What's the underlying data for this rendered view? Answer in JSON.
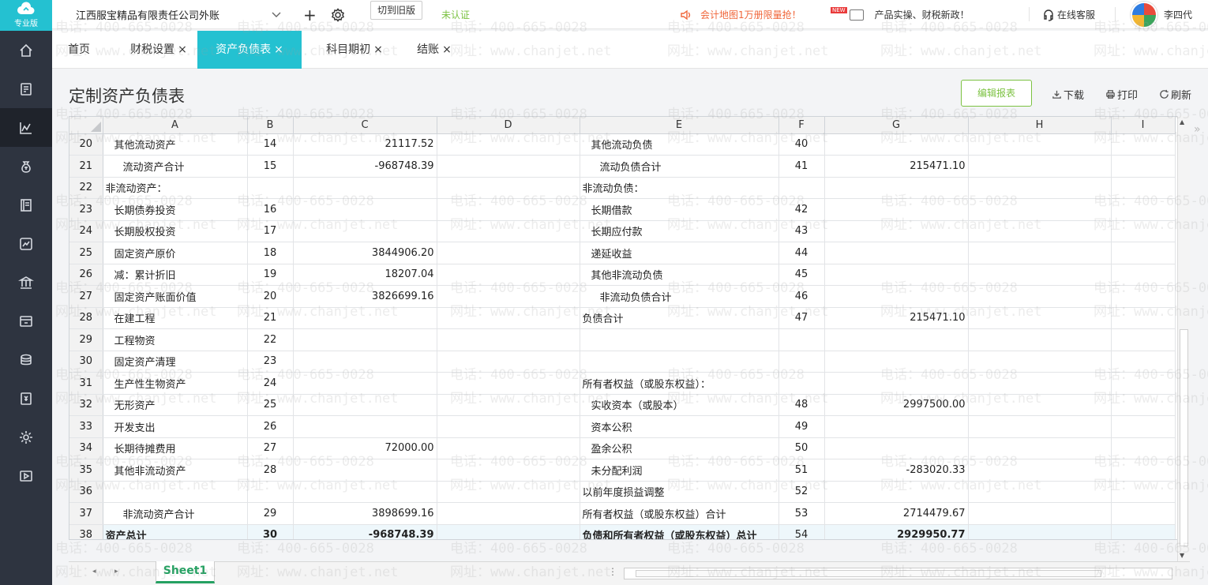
{
  "app": {
    "logo_label": "专业版",
    "company": "江西服宝精品有限责任公司外账",
    "switch_label": "切到旧版",
    "uncertified": "未认证",
    "promo": "会计地图1万册限量抢！",
    "news_badge": "NEW",
    "news": "产品实操、财税新政！",
    "service": "在线客服",
    "user": "李四代"
  },
  "tabs": [
    {
      "label": "首页"
    },
    {
      "label": "财税设置"
    },
    {
      "label": "资产负债表"
    },
    {
      "label": "科目期初"
    },
    {
      "label": "结账"
    }
  ],
  "tab_close": "×",
  "page": {
    "title": "定制资产负债表",
    "edit_label": "编辑报表",
    "download": "下载",
    "print": "打印",
    "refresh": "刷新"
  },
  "columns": [
    "A",
    "B",
    "C",
    "D",
    "E",
    "F",
    "G",
    "H",
    "I"
  ],
  "rows": [
    {
      "n": "20",
      "a": "其他流动资产",
      "ai": 1,
      "b": "14",
      "c": "21117.52",
      "e": "其他流动负债",
      "ei": 1,
      "f": "40",
      "g": ""
    },
    {
      "n": "21",
      "a": "流动资产合计",
      "ai": 2,
      "b": "15",
      "c": "-968748.39",
      "e": "流动负债合计",
      "ei": 2,
      "f": "41",
      "g": "215471.10"
    },
    {
      "n": "22",
      "a": "非流动资产：",
      "ai": 0,
      "b": "",
      "c": "",
      "e": "非流动负债：",
      "ei": 0,
      "f": "",
      "g": ""
    },
    {
      "n": "23",
      "a": "长期债券投资",
      "ai": 1,
      "b": "16",
      "c": "",
      "e": "长期借款",
      "ei": 1,
      "f": "42",
      "g": ""
    },
    {
      "n": "24",
      "a": "长期股权投资",
      "ai": 1,
      "b": "17",
      "c": "",
      "e": "长期应付款",
      "ei": 1,
      "f": "43",
      "g": ""
    },
    {
      "n": "25",
      "a": "固定资产原价",
      "ai": 1,
      "b": "18",
      "c": "3844906.20",
      "e": "递延收益",
      "ei": 1,
      "f": "44",
      "g": ""
    },
    {
      "n": "26",
      "a": "减：累计折旧",
      "ai": 1,
      "b": "19",
      "c": "18207.04",
      "e": "其他非流动负债",
      "ei": 1,
      "f": "45",
      "g": ""
    },
    {
      "n": "27",
      "a": "固定资产账面价值",
      "ai": 1,
      "b": "20",
      "c": "3826699.16",
      "e": "非流动负债合计",
      "ei": 2,
      "f": "46",
      "g": ""
    },
    {
      "n": "28",
      "a": "在建工程",
      "ai": 1,
      "b": "21",
      "c": "",
      "e": "负债合计",
      "ei": 0,
      "f": "47",
      "g": "215471.10"
    },
    {
      "n": "29",
      "a": "工程物资",
      "ai": 1,
      "b": "22",
      "c": "",
      "e": "",
      "ei": 0,
      "f": "",
      "g": ""
    },
    {
      "n": "30",
      "a": "固定资产清理",
      "ai": 1,
      "b": "23",
      "c": "",
      "e": "",
      "ei": 0,
      "f": "",
      "g": ""
    },
    {
      "n": "31",
      "a": "生产性生物资产",
      "ai": 1,
      "b": "24",
      "c": "",
      "e": "所有者权益（或股东权益）：",
      "ei": 0,
      "f": "",
      "g": ""
    },
    {
      "n": "32",
      "a": "无形资产",
      "ai": 1,
      "b": "25",
      "c": "",
      "e": "实收资本（或股本）",
      "ei": 1,
      "f": "48",
      "g": "2997500.00"
    },
    {
      "n": "33",
      "a": "开发支出",
      "ai": 1,
      "b": "26",
      "c": "",
      "e": "资本公积",
      "ei": 1,
      "f": "49",
      "g": ""
    },
    {
      "n": "34",
      "a": "长期待摊费用",
      "ai": 1,
      "b": "27",
      "c": "72000.00",
      "e": "盈余公积",
      "ei": 1,
      "f": "50",
      "g": ""
    },
    {
      "n": "35",
      "a": "其他非流动资产",
      "ai": 1,
      "b": "28",
      "c": "",
      "e": "未分配利润",
      "ei": 1,
      "f": "51",
      "g": "-283020.33"
    },
    {
      "n": "36",
      "a": "",
      "ai": 0,
      "b": "",
      "c": "",
      "e": "以前年度损益调整",
      "ei": 0,
      "f": "52",
      "g": ""
    },
    {
      "n": "37",
      "a": "非流动资产合计",
      "ai": 2,
      "b": "29",
      "c": "3898699.16",
      "e": "所有者权益（或股东权益）合计",
      "ei": 0,
      "f": "53",
      "g": "2714479.67"
    },
    {
      "n": "38",
      "a": "资产总计",
      "ai": 0,
      "b": "30",
      "c": "-968748.39",
      "e": "负债和所有者权益（或股东权益）总计",
      "ei": 0,
      "f": "54",
      "g": "2929950.77",
      "total": true
    }
  ],
  "sheet_tab": "Sheet1",
  "watermark": {
    "phone": "电话：400-665-0028",
    "site": "网址：www.chanjet.net"
  }
}
